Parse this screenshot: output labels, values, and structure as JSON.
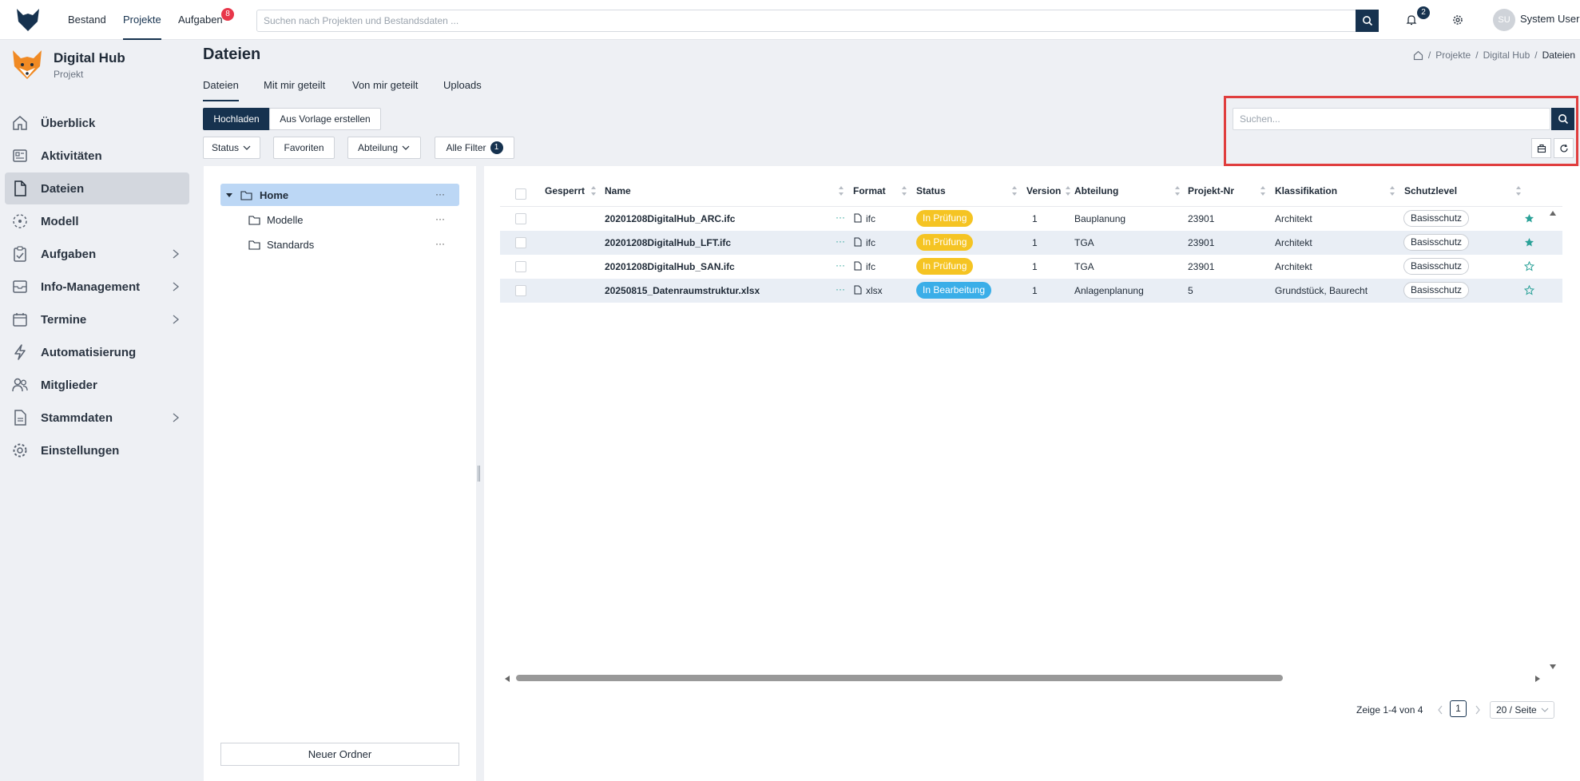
{
  "topnav": {
    "items": [
      {
        "label": "Bestand"
      },
      {
        "label": "Projekte"
      },
      {
        "label": "Aufgaben",
        "badge": "8"
      }
    ],
    "search_placeholder": "Suchen nach Projekten und Bestandsdaten ...",
    "notifications_badge": "2",
    "user_initials": "SU",
    "user_name": "System User"
  },
  "project": {
    "name": "Digital Hub",
    "subtitle": "Projekt"
  },
  "sidebar": {
    "items": [
      {
        "label": "Überblick",
        "icon": "home-icon"
      },
      {
        "label": "Aktivitäten",
        "icon": "activity-icon"
      },
      {
        "label": "Dateien",
        "icon": "file-icon"
      },
      {
        "label": "Modell",
        "icon": "model-icon"
      },
      {
        "label": "Aufgaben",
        "icon": "task-icon"
      },
      {
        "label": "Info-Management",
        "icon": "inbox-icon"
      },
      {
        "label": "Termine",
        "icon": "calendar-icon"
      },
      {
        "label": "Automatisierung",
        "icon": "lightning-icon"
      },
      {
        "label": "Mitglieder",
        "icon": "users-icon"
      },
      {
        "label": "Stammdaten",
        "icon": "document-icon"
      },
      {
        "label": "Einstellungen",
        "icon": "gear-icon"
      }
    ]
  },
  "page": {
    "title": "Dateien",
    "breadcrumb": [
      "Projekte",
      "Digital Hub",
      "Dateien"
    ],
    "tabs": [
      "Dateien",
      "Mit mir geteilt",
      "Von mir geteilt",
      "Uploads"
    ]
  },
  "toolbar": {
    "upload": "Hochladen",
    "from_template": "Aus Vorlage erstellen",
    "status": "Status",
    "favorites": "Favoriten",
    "department": "Abteilung",
    "all_filters": "Alle Filter",
    "all_filters_count": "1",
    "search_placeholder": "Suchen..."
  },
  "folders": {
    "items": [
      "Home",
      "Modelle",
      "Standards"
    ],
    "more": "···",
    "new_folder": "Neuer Ordner"
  },
  "table": {
    "columns": [
      "Gesperrt",
      "Name",
      "Format",
      "Status",
      "Version",
      "Abteilung",
      "Projekt-Nr",
      "Klassifikation",
      "Schutzlevel"
    ],
    "rows": [
      {
        "name": "20201208DigitalHub_ARC.ifc",
        "format": "ifc",
        "status": "In Prüfung",
        "version": "1",
        "department": "Bauplanung",
        "project_no": "23901",
        "classification": "Architekt",
        "protection": "Basisschutz",
        "favorite": true
      },
      {
        "name": "20201208DigitalHub_LFT.ifc",
        "format": "ifc",
        "status": "In Prüfung",
        "version": "1",
        "department": "TGA",
        "project_no": "23901",
        "classification": "Architekt",
        "protection": "Basisschutz",
        "favorite": true
      },
      {
        "name": "20201208DigitalHub_SAN.ifc",
        "format": "ifc",
        "status": "In Prüfung",
        "version": "1",
        "department": "TGA",
        "project_no": "23901",
        "classification": "Architekt",
        "protection": "Basisschutz",
        "favorite": false
      },
      {
        "name": "20250815_Datenraumstruktur.xlsx",
        "format": "xlsx",
        "status": "In Bearbeitung",
        "version": "1",
        "department": "Anlagenplanung",
        "project_no": "5",
        "classification": "Grundstück, Baurecht",
        "protection": "Basisschutz",
        "favorite": false
      }
    ],
    "row_more": "···",
    "status_colors": {
      "In Prüfung": "#f5c423",
      "In Bearbeitung": "#3aaee8"
    },
    "favorite_color": "#2aa198"
  },
  "pagination": {
    "summary": "Zeige 1-4 von 4",
    "current_page": "1",
    "per_page": "20 / Seite"
  },
  "colors": {
    "brand": "#16324f",
    "highlight": "#e03e3e"
  }
}
